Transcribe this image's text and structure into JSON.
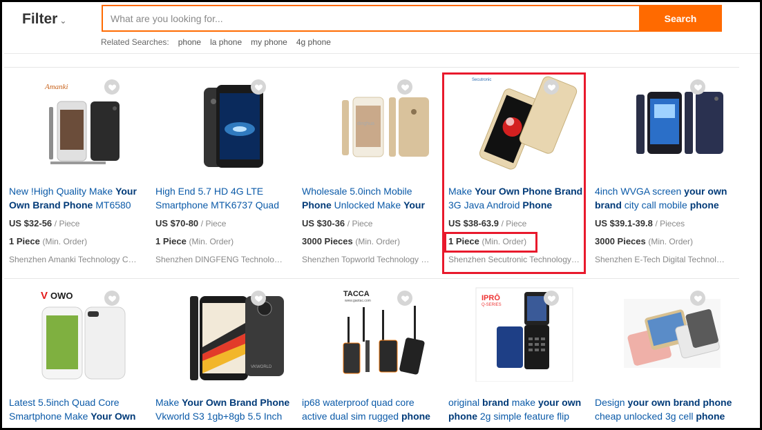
{
  "header": {
    "filter_label": "Filter",
    "search_placeholder": "What are you looking for...",
    "search_value": "",
    "search_button": "Search",
    "related_label": "Related Searches:",
    "related_keywords": [
      "phone",
      "la phone",
      "my phone",
      "4g phone"
    ]
  },
  "products": [
    {
      "title_parts": [
        [
          "New !High Quality Make ",
          false
        ],
        [
          "Your Own Brand Phone",
          true
        ],
        [
          " MT6580",
          false
        ]
      ],
      "price": "US $32-56",
      "price_unit": "/ Piece",
      "moq": "1 Piece",
      "moq_unit": "(Min. Order)",
      "supplier": "Shenzhen Amanki Technology Co., Ltd.",
      "image_brand": "Amanki"
    },
    {
      "title_parts": [
        [
          "High End 5.7 HD 4G LTE Smartphone MTK6737 Quad",
          false
        ]
      ],
      "price": "US $70-80",
      "price_unit": "/ Piece",
      "moq": "1 Piece",
      "moq_unit": "(Min. Order)",
      "supplier": "Shenzhen DINGFENG Technology Co., Ltd."
    },
    {
      "title_parts": [
        [
          "Wholesale 5.0inch Mobile ",
          false
        ],
        [
          "Phone",
          true
        ],
        [
          " Unlocked Make ",
          false
        ],
        [
          "Your",
          true
        ]
      ],
      "price": "US $30-36",
      "price_unit": "/ Piece",
      "moq": "3000 Pieces",
      "moq_unit": "(Min. Order)",
      "supplier": "Shenzhen Topworld Technology Co., Ltd."
    },
    {
      "title_parts": [
        [
          "Make ",
          false
        ],
        [
          "Your Own Phone Brand",
          true
        ],
        [
          " 3G Java Android ",
          false
        ],
        [
          "Phone",
          true
        ]
      ],
      "price": "US $38-63.9",
      "price_unit": "/ Piece",
      "moq": "1 Piece",
      "moq_unit": "(Min. Order)",
      "supplier": "Shenzhen Secutronic Technology Co., Ltd."
    },
    {
      "title_parts": [
        [
          "4inch WVGA screen ",
          false
        ],
        [
          "your own brand",
          true
        ],
        [
          " city call mobile ",
          false
        ],
        [
          "phone",
          true
        ]
      ],
      "price": "US $39.1-39.8",
      "price_unit": "/ Pieces",
      "moq": "3000 Pieces",
      "moq_unit": "(Min. Order)",
      "supplier": "Shenzhen E-Tech Digital Technology Co., Ltd."
    },
    {
      "title_parts": [
        [
          "Latest 5.5inch Quad Core Smartphone Make ",
          false
        ],
        [
          "Your Own",
          true
        ]
      ],
      "image_brand": "VOWO"
    },
    {
      "title_parts": [
        [
          "Make ",
          false
        ],
        [
          "Your Own Brand Phone",
          true
        ],
        [
          " Vkworld S3 1gb+8gb 5.5 Inch",
          false
        ]
      ],
      "image_brand": "VKWORLD"
    },
    {
      "title_parts": [
        [
          "ip68 waterproof quad core active dual sim rugged ",
          false
        ],
        [
          "phone",
          true
        ]
      ],
      "image_brand": "TACCA"
    },
    {
      "title_parts": [
        [
          "original ",
          false
        ],
        [
          "brand",
          true
        ],
        [
          " make ",
          false
        ],
        [
          "your own",
          true
        ],
        [
          " ",
          false
        ],
        [
          "phone",
          true
        ],
        [
          " 2g simple feature flip",
          false
        ]
      ],
      "image_brand": "IPRO"
    },
    {
      "title_parts": [
        [
          "Design ",
          false
        ],
        [
          "your own brand phone",
          true
        ],
        [
          " cheap unlocked 3g cell ",
          false
        ],
        [
          "phone",
          true
        ]
      ]
    }
  ],
  "colors": {
    "accent": "#ff6a00",
    "link": "#0b5aa8",
    "highlight": "#e8192c"
  },
  "icons": {
    "favorite": "heart-icon",
    "filter_dropdown": "chevron-down-icon"
  }
}
